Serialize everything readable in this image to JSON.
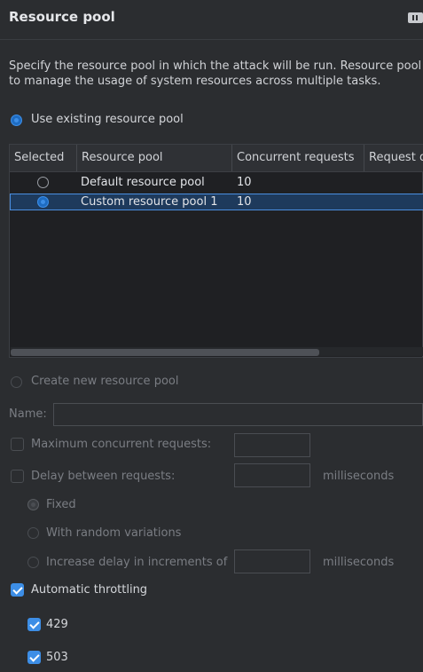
{
  "header": {
    "title": "Resource pool"
  },
  "description": {
    "line1": "Specify the resource pool in which the attack will be run. Resource pool",
    "line2": "to manage the usage of system resources across multiple tasks."
  },
  "use_existing": {
    "label": "Use existing resource pool",
    "selected": true
  },
  "table": {
    "columns": [
      "Selected",
      "Resource pool",
      "Concurrent requests",
      "Request d"
    ],
    "rows": [
      {
        "selected": false,
        "name": "Default resource pool",
        "concurrent": "10"
      },
      {
        "selected": true,
        "name": "Custom resource pool 1",
        "concurrent": "10"
      }
    ]
  },
  "create_new": {
    "label": "Create new resource pool",
    "selected": false
  },
  "name_field": {
    "label": "Name:",
    "value": ""
  },
  "max_concurrent": {
    "label": "Maximum concurrent requests:",
    "checked": false,
    "value": ""
  },
  "delay": {
    "label": "Delay between requests:",
    "checked": false,
    "value": "",
    "unit": "milliseconds"
  },
  "delay_options": {
    "fixed": "Fixed",
    "random": "With random variations",
    "increase": "Increase delay in increments of",
    "increase_unit": "milliseconds"
  },
  "auto_throttling": {
    "label": "Automatic throttling",
    "checked": true
  },
  "codes": [
    {
      "label": "429",
      "checked": true
    },
    {
      "label": "503",
      "checked": true
    }
  ],
  "colors": {
    "accent": "#3d8ee6",
    "background": "#2b2d30",
    "selected_row": "#1e3a5c"
  }
}
